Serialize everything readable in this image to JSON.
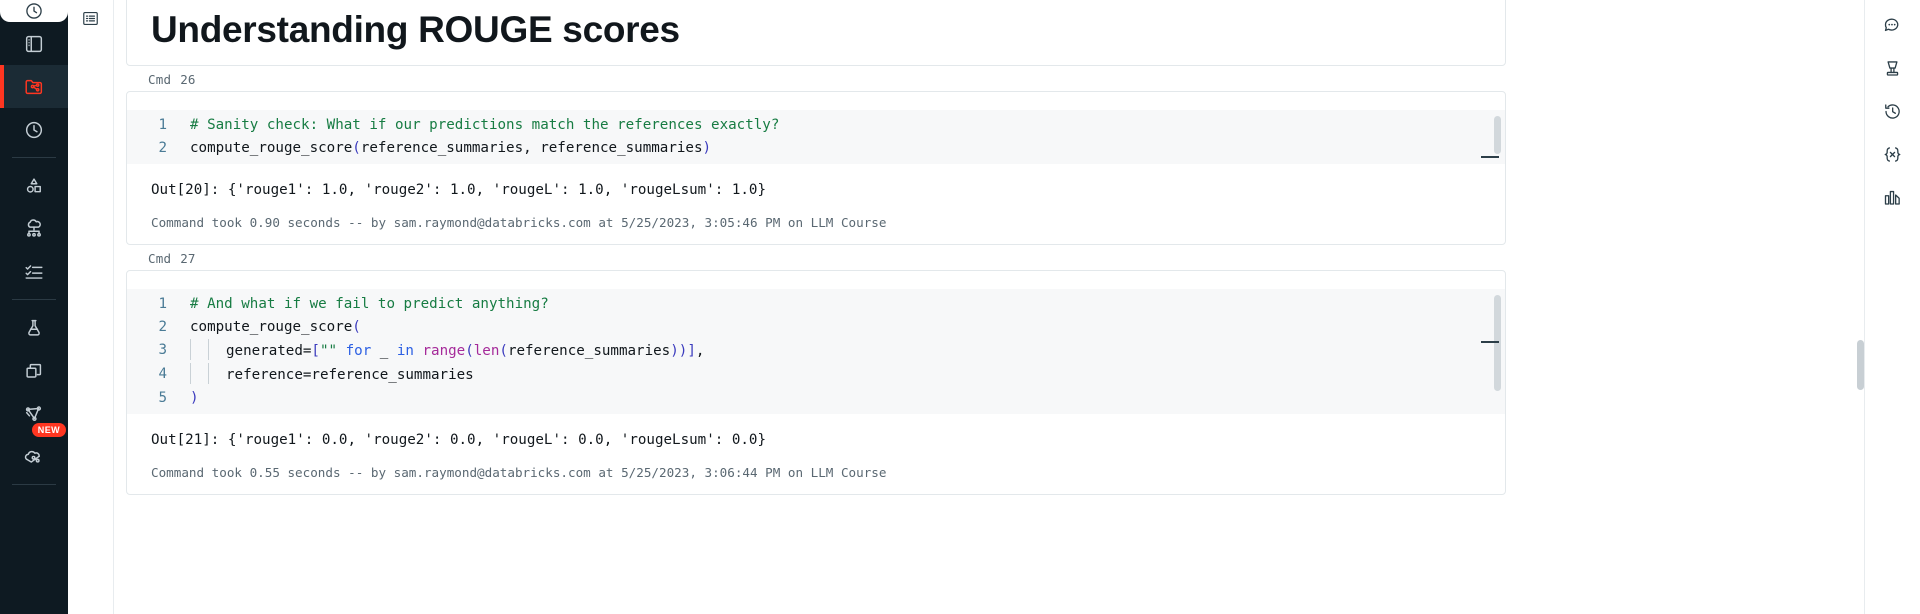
{
  "left_rail": {
    "items": [
      {
        "name": "recents-tab-icon",
        "label": "Recents",
        "state": "tab"
      },
      {
        "name": "workspace-icon",
        "label": "Workspace",
        "state": "normal"
      },
      {
        "name": "repos-icon",
        "label": "Repos",
        "state": "active"
      },
      {
        "name": "recents-clock-icon",
        "label": "Recents",
        "state": "normal"
      },
      {
        "name": "divider-1",
        "label": "",
        "state": "divider"
      },
      {
        "name": "data-shapes-icon",
        "label": "Data",
        "state": "normal"
      },
      {
        "name": "compute-icon",
        "label": "Compute",
        "state": "normal"
      },
      {
        "name": "workflows-checklist-icon",
        "label": "Workflows",
        "state": "normal"
      },
      {
        "name": "divider-2",
        "label": "",
        "state": "divider"
      },
      {
        "name": "experiments-flask-icon",
        "label": "Experiments",
        "state": "normal"
      },
      {
        "name": "models-stack-icon",
        "label": "Models",
        "state": "normal"
      },
      {
        "name": "feature-store-graph-icon",
        "label": "Feature Store",
        "state": "normal"
      },
      {
        "name": "partner-connect-icon",
        "label": "Partner Connect",
        "state": "normal",
        "badge": "NEW"
      }
    ],
    "badge_new": "NEW"
  },
  "toc_rail": {
    "toggle": {
      "name": "table-of-contents-icon",
      "label": "Table of contents"
    }
  },
  "notebook": {
    "title_cell": {
      "title": "Understanding ROUGE scores"
    },
    "cells": [
      {
        "cmd_label": "Cmd",
        "cmd_number": "26",
        "lines": [
          {
            "n": "1",
            "tokens": [
              {
                "t": "# Sanity check: What if our predictions match the references exactly?",
                "c": "comment"
              }
            ]
          },
          {
            "n": "2",
            "tokens": [
              {
                "t": "compute_rouge_score",
                "c": "fn"
              },
              {
                "t": "(",
                "c": "punct"
              },
              {
                "t": "reference_summaries, reference_summaries",
                "c": "ident"
              },
              {
                "t": ")",
                "c": "punct"
              }
            ]
          }
        ],
        "output_label": "Out[20]:",
        "output_value": "{'rouge1': 1.0, 'rouge2': 1.0, 'rougeL': 1.0, 'rougeLsum': 1.0}",
        "footer": "Command took 0.90 seconds -- by sam.raymond@databricks.com at 5/25/2023, 3:05:46 PM on LLM Course"
      },
      {
        "cmd_label": "Cmd",
        "cmd_number": "27",
        "lines": [
          {
            "n": "1",
            "tokens": [
              {
                "t": "# And what if we fail to predict anything?",
                "c": "comment"
              }
            ]
          },
          {
            "n": "2",
            "tokens": [
              {
                "t": "compute_rouge_score",
                "c": "fn"
              },
              {
                "t": "(",
                "c": "punct"
              }
            ]
          },
          {
            "n": "3",
            "indent": 2,
            "tokens": [
              {
                "t": "generated=",
                "c": "ident"
              },
              {
                "t": "[",
                "c": "punct"
              },
              {
                "t": "\"\"",
                "c": "strlit"
              },
              {
                "t": " ",
                "c": "ident"
              },
              {
                "t": "for",
                "c": "kw"
              },
              {
                "t": " _ ",
                "c": "ident"
              },
              {
                "t": "in",
                "c": "kw"
              },
              {
                "t": " ",
                "c": "ident"
              },
              {
                "t": "range",
                "c": "builtin"
              },
              {
                "t": "(",
                "c": "punct"
              },
              {
                "t": "len",
                "c": "builtin"
              },
              {
                "t": "(",
                "c": "punct"
              },
              {
                "t": "reference_summaries",
                "c": "ident"
              },
              {
                "t": ")",
                "c": "punct"
              },
              {
                "t": ")",
                "c": "punct"
              },
              {
                "t": "]",
                "c": "punct"
              },
              {
                "t": ",",
                "c": "ident"
              }
            ]
          },
          {
            "n": "4",
            "indent": 2,
            "tokens": [
              {
                "t": "reference=reference_summaries",
                "c": "ident"
              }
            ]
          },
          {
            "n": "5",
            "tokens": [
              {
                "t": ")",
                "c": "punct"
              }
            ]
          }
        ],
        "output_label": "Out[21]:",
        "output_value": "{'rouge1': 0.0, 'rouge2': 0.0, 'rougeL': 0.0, 'rougeLsum': 0.0}",
        "footer": "Command took 0.55 seconds -- by sam.raymond@databricks.com at 5/25/2023, 3:06:44 PM on LLM Course"
      }
    ]
  },
  "right_rail": {
    "items": [
      {
        "name": "comments-icon",
        "label": "Comments"
      },
      {
        "name": "cluster-icon",
        "label": "Cluster"
      },
      {
        "name": "revision-history-icon",
        "label": "Revision history"
      },
      {
        "name": "variables-icon",
        "label": "Variables"
      },
      {
        "name": "data-profile-icon",
        "label": "Data profile"
      }
    ]
  },
  "colors": {
    "accent": "#FF3621",
    "rail_bg": "#0E1A22",
    "comment": "#177C43",
    "keyword": "#2B5FE3",
    "builtin": "#A52A9A",
    "punct": "#3B3BBE"
  }
}
